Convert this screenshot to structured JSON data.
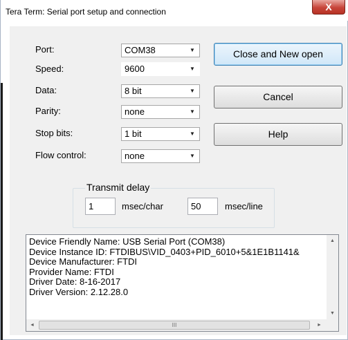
{
  "window": {
    "title": "Tera Term: Serial port setup and connection",
    "close_symbol": "X"
  },
  "fields": [
    {
      "label": "Port:",
      "value": "COM38"
    },
    {
      "label": "Speed:",
      "value": "9600"
    },
    {
      "label": "Data:",
      "value": "8 bit"
    },
    {
      "label": "Parity:",
      "value": "none"
    },
    {
      "label": "Stop bits:",
      "value": "1 bit"
    },
    {
      "label": "Flow control:",
      "value": "none"
    }
  ],
  "buttons": {
    "close_new_open": "Close and New open",
    "cancel": "Cancel",
    "help": "Help"
  },
  "transmit_delay": {
    "title": "Transmit delay",
    "char_value": "1",
    "char_unit": "msec/char",
    "line_value": "50",
    "line_unit": "msec/line"
  },
  "device_info": {
    "lines": [
      "Device Friendly Name: USB Serial Port (COM38)",
      "Device Instance ID: FTDIBUS\\VID_0403+PID_6010+5&1E1B1141&",
      "Device Manufacturer: FTDI",
      "Provider Name: FTDI",
      "Driver Date: 8-16-2017",
      "Driver Version: 2.12.28.0"
    ]
  },
  "icons": {
    "dropdown": "▼",
    "scroll_up": "▲",
    "scroll_down": "▼",
    "scroll_left": "◄",
    "scroll_right": "►",
    "thumb_grip": "III"
  }
}
